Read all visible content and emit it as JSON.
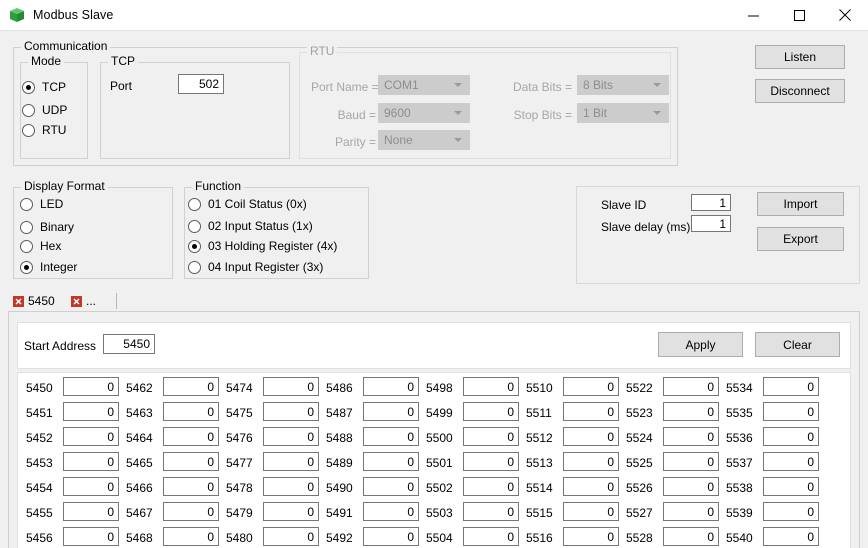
{
  "window": {
    "title": "Modbus Slave",
    "icon": "cube-icon",
    "controls": {
      "minimize": "minimize-icon",
      "maximize": "maximize-icon",
      "close": "close-icon"
    }
  },
  "communication": {
    "legend": "Communication",
    "mode": {
      "legend": "Mode",
      "options": [
        "TCP",
        "UDP",
        "RTU"
      ],
      "selected": "TCP"
    },
    "tcp": {
      "legend": "TCP",
      "port_label": "Port",
      "port_value": "502"
    },
    "rtu": {
      "legend": "RTU",
      "disabled": true,
      "fields": [
        {
          "label": "Port Name =",
          "value": "COM1"
        },
        {
          "label": "Baud =",
          "value": "9600"
        },
        {
          "label": "Parity =",
          "value": "None"
        },
        {
          "label": "Data Bits =",
          "value": "8 Bits"
        },
        {
          "label": "Stop Bits =",
          "value": "1 Bit"
        }
      ]
    }
  },
  "connection_buttons": {
    "listen": "Listen",
    "disconnect": "Disconnect"
  },
  "display_format": {
    "legend": "Display Format",
    "options": [
      "LED",
      "Binary",
      "Hex",
      "Integer"
    ],
    "selected": "Integer"
  },
  "function": {
    "legend": "Function",
    "options": [
      "01 Coil Status (0x)",
      "02 Input Status (1x)",
      "03 Holding Register (4x)",
      "04 Input Register (3x)"
    ],
    "selected": "03 Holding Register (4x)"
  },
  "slave": {
    "id_label": "Slave ID",
    "id_value": "1",
    "delay_label": "Slave delay (ms)",
    "delay_value": "1",
    "import_label": "Import",
    "export_label": "Export"
  },
  "tabs": [
    {
      "label": "5450",
      "active": true,
      "close_icon": "close-tab-icon"
    },
    {
      "label": "...",
      "active": false,
      "close_icon": "close-tab-icon"
    }
  ],
  "address_bar": {
    "start_address_label": "Start Address",
    "start_address_value": "5450",
    "apply_label": "Apply",
    "clear_label": "Clear"
  },
  "register_grid": {
    "column_start_addresses": [
      5450,
      5462,
      5474,
      5486,
      5498,
      5510,
      5522,
      5534
    ],
    "rows_visible": 7,
    "default_value": "0",
    "columns": [
      {
        "addresses": [
          "5450",
          "5451",
          "5452",
          "5453",
          "5454",
          "5455",
          "5456"
        ],
        "values": [
          "0",
          "0",
          "0",
          "0",
          "0",
          "0",
          "0"
        ]
      },
      {
        "addresses": [
          "5462",
          "5463",
          "5464",
          "5465",
          "5466",
          "5467",
          "5468"
        ],
        "values": [
          "0",
          "0",
          "0",
          "0",
          "0",
          "0",
          "0"
        ]
      },
      {
        "addresses": [
          "5474",
          "5475",
          "5476",
          "5477",
          "5478",
          "5479",
          "5480"
        ],
        "values": [
          "0",
          "0",
          "0",
          "0",
          "0",
          "0",
          "0"
        ]
      },
      {
        "addresses": [
          "5486",
          "5487",
          "5488",
          "5489",
          "5490",
          "5491",
          "5492"
        ],
        "values": [
          "0",
          "0",
          "0",
          "0",
          "0",
          "0",
          "0"
        ]
      },
      {
        "addresses": [
          "5498",
          "5499",
          "5500",
          "5501",
          "5502",
          "5503",
          "5504"
        ],
        "values": [
          "0",
          "0",
          "0",
          "0",
          "0",
          "0",
          "0"
        ]
      },
      {
        "addresses": [
          "5510",
          "5511",
          "5512",
          "5513",
          "5514",
          "5515",
          "5516"
        ],
        "values": [
          "0",
          "0",
          "0",
          "0",
          "0",
          "0",
          "0"
        ]
      },
      {
        "addresses": [
          "5522",
          "5523",
          "5524",
          "5525",
          "5526",
          "5527",
          "5528"
        ],
        "values": [
          "0",
          "0",
          "0",
          "0",
          "0",
          "0",
          "0"
        ]
      },
      {
        "addresses": [
          "5534",
          "5535",
          "5536",
          "5537",
          "5538",
          "5539",
          "5540"
        ],
        "values": [
          "0",
          "0",
          "0",
          "0",
          "0",
          "0",
          "0"
        ]
      }
    ]
  },
  "colors": {
    "window_bg": "#f0f0f0",
    "titlebar_bg": "#ffffff",
    "accent_tab_close": "#c0392b",
    "icon_green": "#2f9e41",
    "button_face": "#e1e1e1",
    "disabled_combo": "#cccccc"
  }
}
